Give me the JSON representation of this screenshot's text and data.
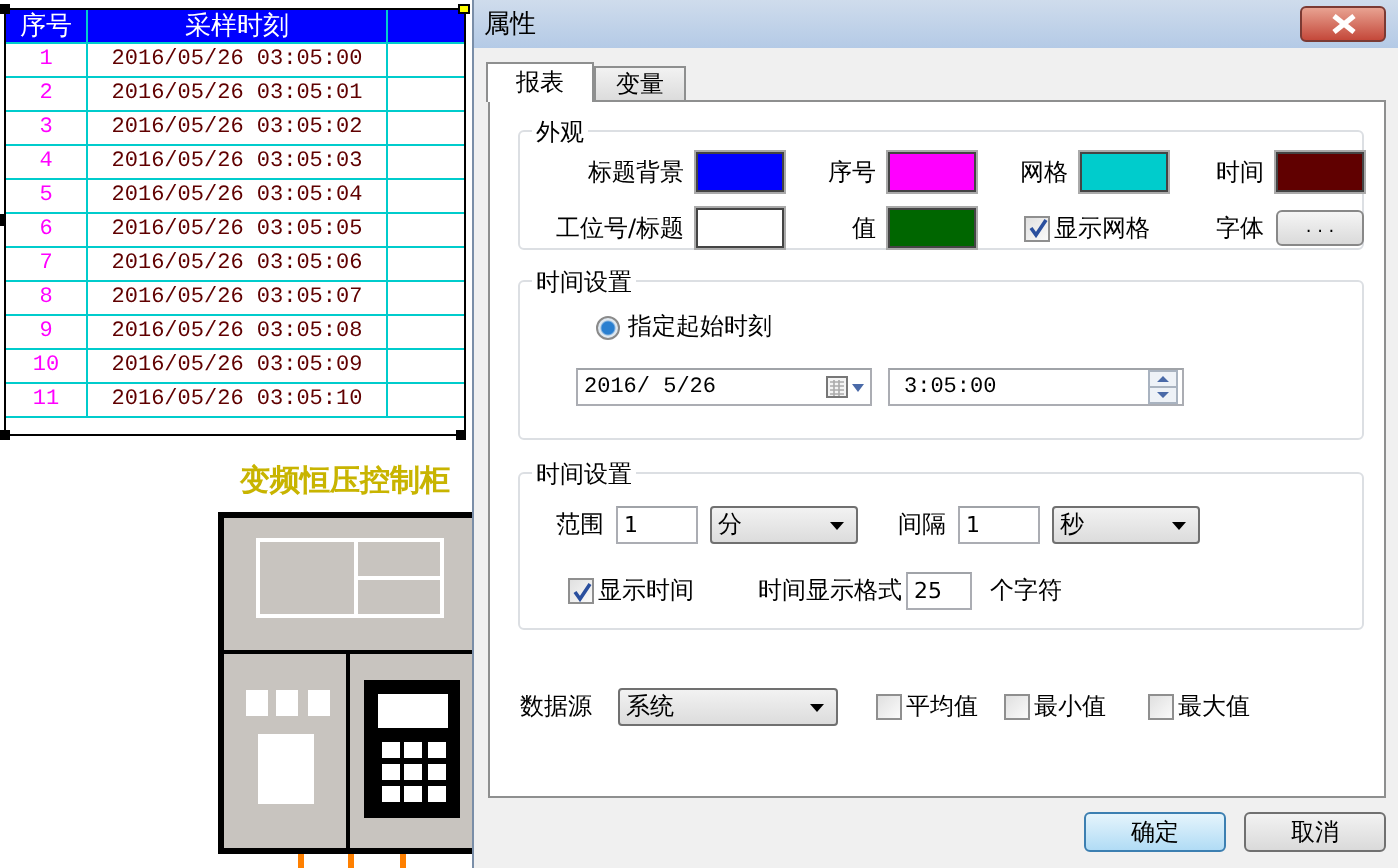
{
  "canvas": {
    "table": {
      "columns": [
        "序号",
        "采样时刻"
      ],
      "rows": [
        {
          "seq": "1",
          "time": "2016/05/26 03:05:00"
        },
        {
          "seq": "2",
          "time": "2016/05/26 03:05:01"
        },
        {
          "seq": "3",
          "time": "2016/05/26 03:05:02"
        },
        {
          "seq": "4",
          "time": "2016/05/26 03:05:03"
        },
        {
          "seq": "5",
          "time": "2016/05/26 03:05:04"
        },
        {
          "seq": "6",
          "time": "2016/05/26 03:05:05"
        },
        {
          "seq": "7",
          "time": "2016/05/26 03:05:06"
        },
        {
          "seq": "8",
          "time": "2016/05/26 03:05:07"
        },
        {
          "seq": "9",
          "time": "2016/05/26 03:05:08"
        },
        {
          "seq": "10",
          "time": "2016/05/26 03:05:09"
        },
        {
          "seq": "11",
          "time": "2016/05/26 03:05:10"
        }
      ]
    },
    "title": "变频恒压控制柜"
  },
  "dialog": {
    "title": "属性",
    "tabs": [
      {
        "label": "报表",
        "selected": true
      },
      {
        "label": "变量",
        "selected": false
      }
    ],
    "appearance": {
      "title": "外观",
      "swatches": [
        {
          "label": "标题背景",
          "color": "#0000ff"
        },
        {
          "label": "序号",
          "color": "#ff00ff"
        },
        {
          "label": "网格",
          "color": "#00cccc"
        },
        {
          "label": "时间",
          "color": "#600000"
        },
        {
          "label": "工位号/标题",
          "color": "#ffffff"
        },
        {
          "label": "值",
          "color": "#006600"
        }
      ],
      "show_grid": {
        "label": "显示网格",
        "checked": true
      },
      "font": {
        "label": "字体",
        "button": ". . ."
      }
    },
    "start_time": {
      "title": "时间设置",
      "radio": {
        "label": "指定起始时刻",
        "selected": true
      },
      "date": "2016/ 5/26",
      "time": "3:05:00"
    },
    "range": {
      "title": "时间设置",
      "range_label": "范围",
      "range_value": "1",
      "range_unit": "分",
      "interval_label": "间隔",
      "interval_value": "1",
      "interval_unit": "秒",
      "show_time": {
        "label": "显示时间",
        "checked": true
      },
      "format_label": "时间显示格式",
      "format_value": "25",
      "format_suffix": "个字符"
    },
    "data_source": {
      "label": "数据源",
      "value": "系统",
      "options": [
        {
          "label": "平均值",
          "checked": false
        },
        {
          "label": "最小值",
          "checked": false
        },
        {
          "label": "最大值",
          "checked": false
        }
      ]
    },
    "buttons": [
      {
        "label": "确定",
        "default": true
      },
      {
        "label": "取消",
        "default": false
      }
    ]
  }
}
